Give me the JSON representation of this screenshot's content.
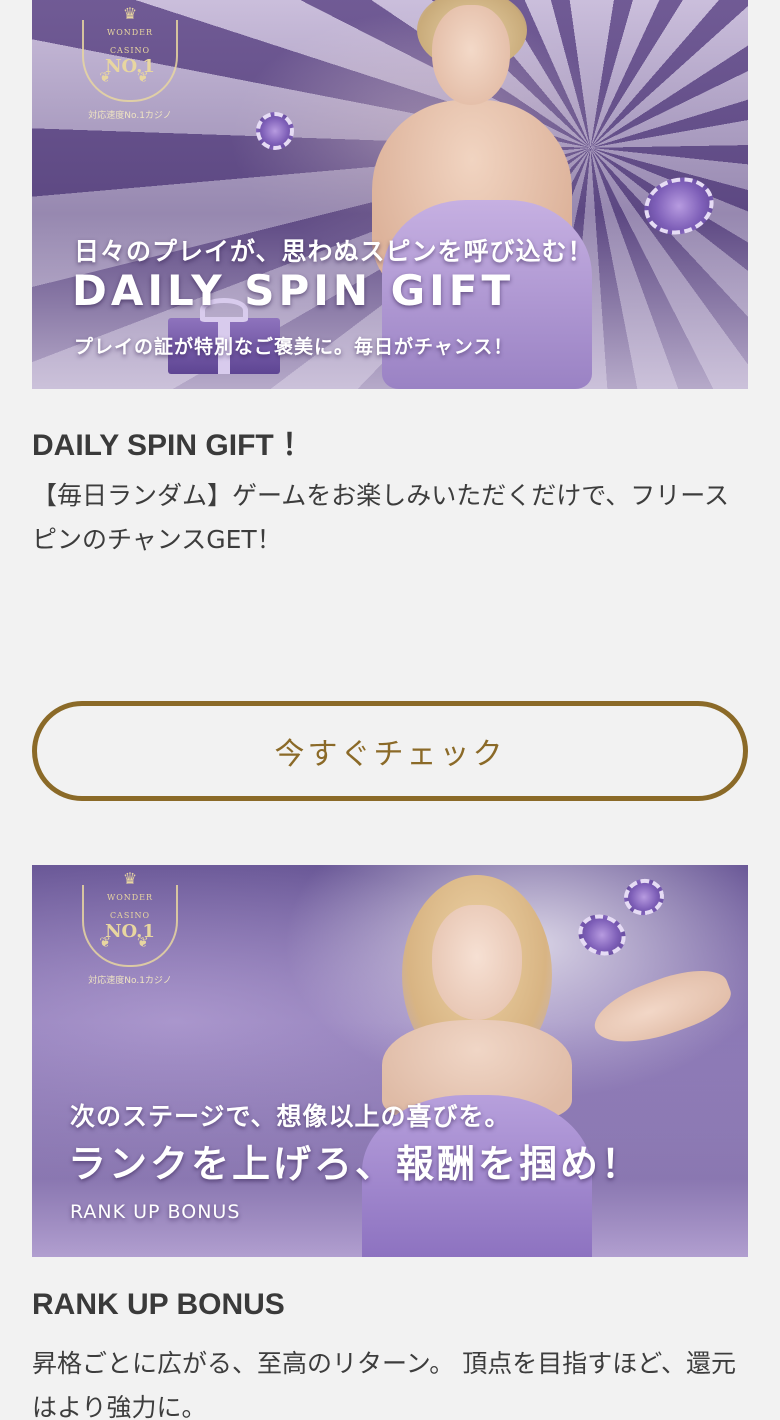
{
  "promos": [
    {
      "banner": {
        "badge": {
          "wonder": "WONDER",
          "casino": "CASINO",
          "no1": "NO.1",
          "caption": "対応速度No.1カジノ"
        },
        "line1": "日々のプレイが、思わぬスピンを呼び込む！",
        "line2": "DAILY SPIN GIFT",
        "line3": "プレイの証が特別なご褒美に。毎日がチャンス！"
      },
      "title": "DAILY SPIN GIFT ！",
      "description": "【毎日ランダム】ゲームをお楽しみいただくだけで、フリースピンのチャンスGET！",
      "cta_label": "今すぐチェック"
    },
    {
      "banner": {
        "badge": {
          "wonder": "WONDER",
          "casino": "CASINO",
          "no1": "NO.1",
          "caption": "対応速度No.1カジノ"
        },
        "line1": "次のステージで、想像以上の喜びを。",
        "line2": "ランクを上げろ、報酬を掴め！",
        "line3": "RANK UP BONUS"
      },
      "title": "RANK UP BONUS",
      "description": "昇格ごとに広がる、至高のリターン。 頂点を目指すほど、還元はより強力に。"
    }
  ],
  "colors": {
    "background": "#f2f2f2",
    "accent_gold": "#8b6a28",
    "text": "#3a3a3a",
    "banner_purple": "#8a74ad"
  }
}
